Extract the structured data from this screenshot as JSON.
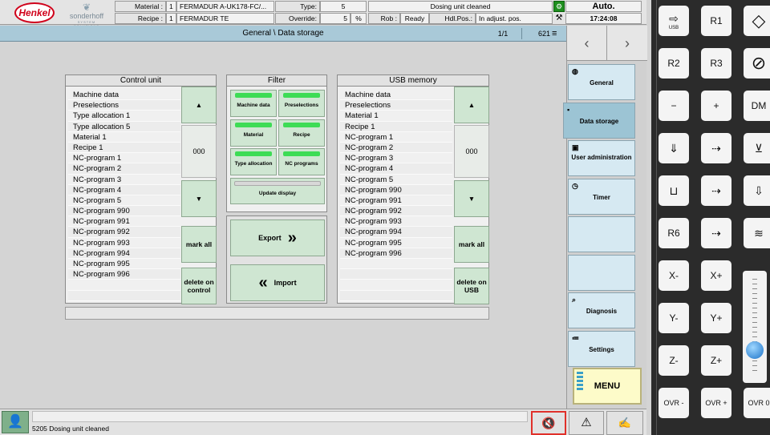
{
  "header": {
    "brand_henkel": "Henkel",
    "brand_sonderhoff": "sonderhoff",
    "brand_sonderhoff_sub": "SYSTEM SOLUTIONS",
    "material_label": "Material :",
    "material_num": "1",
    "material_value": "FERMADUR A-UK178-FC/...",
    "recipe_label": "Recipe :",
    "recipe_num": "1",
    "recipe_value": "FERMADUR TE",
    "type_label": "Type:",
    "type_value": "5",
    "override_label": "Override:",
    "override_value": "5",
    "override_unit": "%",
    "rob_label": "Rob :",
    "rob_value": "Ready",
    "hdl_label": "Hdl.Pos.:",
    "hdl_value": "In adjust. pos.",
    "status_message": "Dosing unit cleaned",
    "mode": "Auto.",
    "time": "17:24:08"
  },
  "titlebar": {
    "title": "General \\ Data storage",
    "page": "1/1",
    "count": "621"
  },
  "control_unit": {
    "title": "Control unit",
    "items": [
      "Machine data",
      "Preselections",
      "Type allocation 1",
      "Type allocation 5",
      "Material 1",
      "Recipe  1",
      "NC-program 1",
      "NC-program 2",
      "NC-program 3",
      "NC-program 4",
      "NC-program 5",
      "NC-program 990",
      "NC-program 991",
      "NC-program 992",
      "NC-program 993",
      "NC-program 994",
      "NC-program 995",
      "NC-program 996",
      "",
      ""
    ],
    "counter": "000",
    "mark_all": "mark all",
    "delete_label": "delete on control"
  },
  "filter": {
    "title": "Filter",
    "buttons": [
      "Machine data",
      "Preselections",
      "Material",
      "Recipe",
      "Type allocation",
      "NC programs"
    ],
    "update": "Update display",
    "export": "Export",
    "import": "Import"
  },
  "usb": {
    "title": "USB memory",
    "items": [
      "Machine data",
      "Preselections",
      "Material 1",
      "Recipe  1",
      "NC-program 1",
      "NC-program 2",
      "NC-program 3",
      "NC-program 4",
      "NC-program 5",
      "NC-program 990",
      "NC-program 991",
      "NC-program 992",
      "NC-program 993",
      "NC-program 994",
      "NC-program 995",
      "NC-program 996",
      "",
      "",
      "",
      ""
    ],
    "counter": "000",
    "mark_all": "mark all",
    "delete_label": "delete on USB"
  },
  "nav": {
    "items": [
      {
        "label": "General",
        "icon": "globe-icon"
      },
      {
        "label": "Data storage",
        "icon": "floppy-icon"
      },
      {
        "label": "User administration",
        "icon": "user-card-icon"
      },
      {
        "label": "Timer",
        "icon": "clock-icon"
      },
      {
        "label": "",
        "icon": ""
      },
      {
        "label": "",
        "icon": ""
      },
      {
        "label": "Diagnosis",
        "icon": "magnifier-icon"
      },
      {
        "label": "Settings",
        "icon": "list-icon"
      }
    ],
    "menu": "MENU"
  },
  "keypad": {
    "keys": [
      "USB",
      "R1",
      "",
      "R2",
      "R3",
      "",
      "−",
      "+",
      "DM",
      "",
      "",
      "",
      "",
      "",
      "",
      "R6",
      "",
      "",
      "X-",
      "X+",
      "",
      "Y-",
      "Y+",
      "",
      "Z-",
      "Z+",
      "",
      "OVR -",
      "OVR +",
      "OVR 0"
    ]
  },
  "statusbar": {
    "message": "5205 Dosing unit cleaned"
  },
  "colors": {
    "accent_green": "#3ddc55",
    "button_green": "#cfe6d2",
    "nav_blue": "#d6e9f2",
    "title_blue": "#a9c9d8",
    "menu_yellow": "#fdfbc9"
  }
}
